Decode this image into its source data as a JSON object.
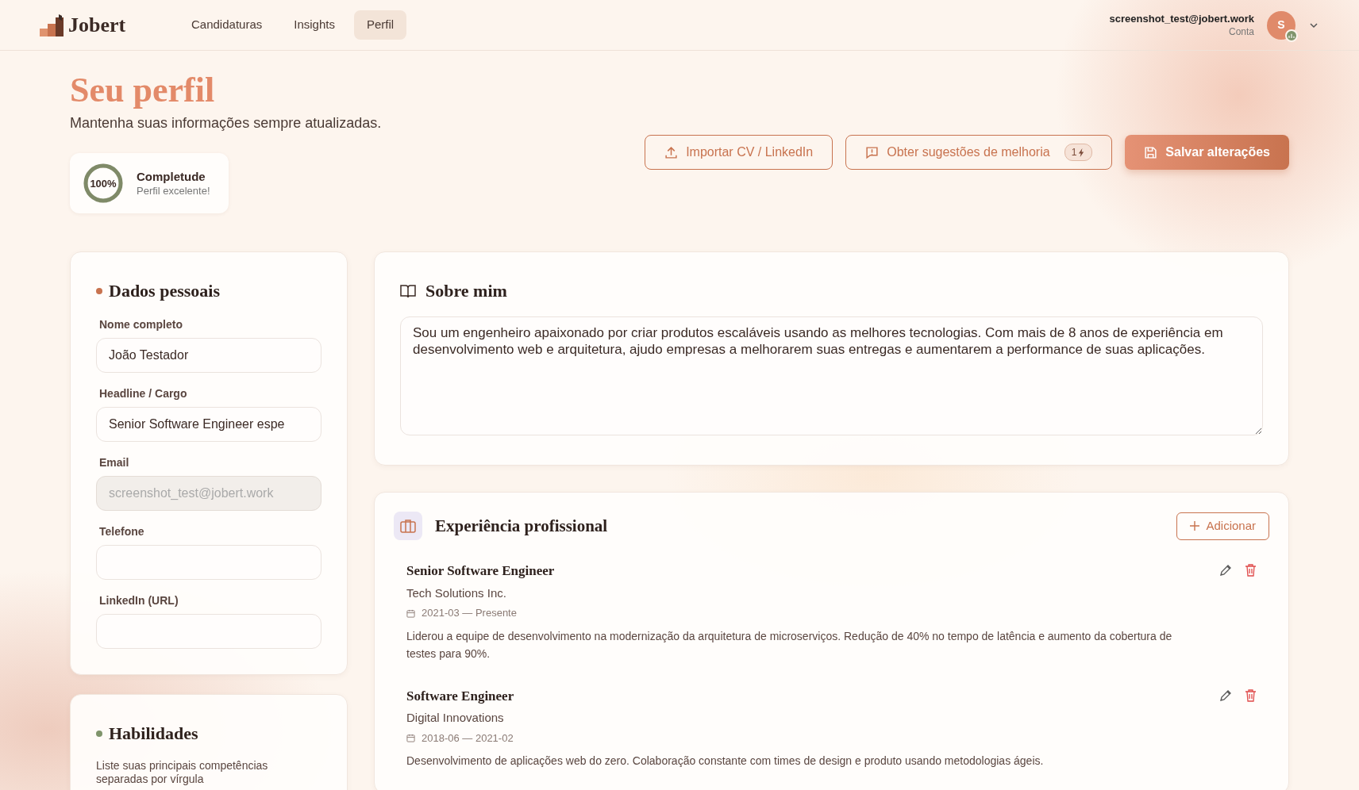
{
  "header": {
    "logo": "Jobert",
    "nav": [
      {
        "label": "Candidaturas",
        "selected": false
      },
      {
        "label": "Insights",
        "selected": false
      },
      {
        "label": "Perfil",
        "selected": true
      }
    ],
    "account": {
      "email": "screenshot_test@jobert.work",
      "label": "Conta",
      "avatar": "S"
    }
  },
  "page": {
    "title": "Seu perfil",
    "subtitle": "Mantenha suas informações sempre atualizadas."
  },
  "actions": [
    {
      "label": "Importar CV / LinkedIn",
      "kind": "outline"
    },
    {
      "label": "Obter sugestões de melhoria",
      "kind": "outline",
      "badge": "1"
    },
    {
      "label": "Salvar alterações",
      "kind": "primary"
    }
  ],
  "completeness": {
    "value": "100%",
    "level": 1,
    "title": "Completude",
    "status": "Perfil excelente!"
  },
  "personal": {
    "title": "Dados pessoais",
    "color": "#c8734f",
    "fields": [
      {
        "label": "Nome completo",
        "value": "João Testador",
        "disabled": false
      },
      {
        "label": "Headline / Cargo",
        "value": "Senior Software Engineer espe",
        "disabled": false
      },
      {
        "label": "Email",
        "value": "screenshot_test@jobert.work",
        "disabled": true
      },
      {
        "label": "Telefone",
        "disabled": false
      },
      {
        "label": "LinkedIn (URL)",
        "disabled": false
      }
    ]
  },
  "skills": {
    "title": "Habilidades",
    "color": "#7f946b",
    "hint": "Liste suas principais competências separadas por vírgula"
  },
  "about": {
    "title": "Sobre mim",
    "text": "Sou um engenheiro apaixonado por criar produtos escaláveis usando as melhores tecnologias. Com mais de 8 anos de experiência em desenvolvimento web e arquitetura, ajudo empresas a melhorarem suas entregas e aumentarem a performance de suas aplicações."
  },
  "experience": {
    "title": "Experiência profissional",
    "add": "Adicionar",
    "items": [
      {
        "role": "Senior Software Engineer",
        "company": "Tech Solutions Inc.",
        "period": "2021-03 — Presente",
        "description": "Liderou a equipe de desenvolvimento na modernização da arquitetura de microserviços. Redução de 40% no tempo de latência e aumento da cobertura de testes para 90%."
      },
      {
        "role": "Software Engineer",
        "company": "Digital Innovations",
        "period": "2018-06 — 2021-02",
        "description": "Desenvolvimento de aplicações web do zero. Colaboração constante com times de design e produto usando metodologias ágeis."
      }
    ]
  }
}
